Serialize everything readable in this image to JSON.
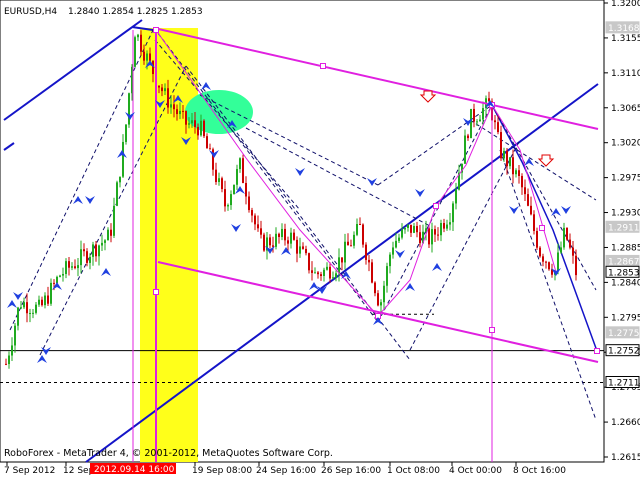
{
  "header": {
    "symbol": "EURUSD,H4",
    "ohlc": "1.2840 1.2854 1.2825 1.2853"
  },
  "footer": {
    "copyright": "RoboForex - MetaTrader 4, © 2001-2012, MetaQuotes Software Corp."
  },
  "crosshair_label": "2012.09.14 16:00",
  "colors": {
    "bull": "#1faa1f",
    "bear": "#cc0000",
    "blue_line": "#1414c8",
    "magenta": "#e020e0",
    "yellow_band": "#ffff1a",
    "ellipse": "#33ff99"
  },
  "chart_data": {
    "type": "candlestick",
    "ylim": [
      1.2615,
      1.32
    ],
    "y_ticks": [
      "1.3200",
      "1.3155",
      "1.3110",
      "1.3065",
      "1.3020",
      "1.2975",
      "1.2930",
      "1.2885",
      "1.2840",
      "1.2795",
      "1.2750",
      "1.2705",
      "1.2660",
      "1.2615"
    ],
    "x_ticks": [
      "7 Sep 2012",
      "12 Sep 16:00",
      "19 Sep 08:00",
      "24 Sep 16:00",
      "26 Sep 16:00",
      "1 Oct 08:00",
      "4 Oct 00:00",
      "8 Oct 16:00"
    ],
    "price_labels": [
      {
        "value": "1.3168",
        "kind": "highlight"
      },
      {
        "value": "1.2911",
        "kind": "highlight"
      },
      {
        "value": "1.2867",
        "kind": "highlight"
      },
      {
        "value": "1.2853",
        "kind": "current"
      },
      {
        "value": "1.2775",
        "kind": "highlight"
      },
      {
        "value": "1.2752",
        "kind": "current"
      },
      {
        "value": "1.2711",
        "kind": "current"
      }
    ]
  }
}
